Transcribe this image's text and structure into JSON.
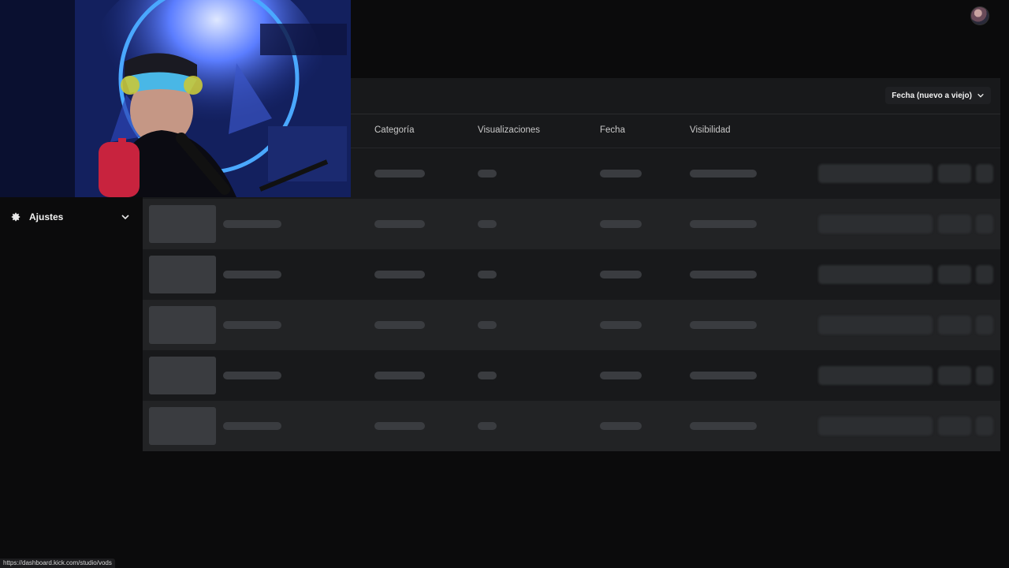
{
  "sidebar": {
    "items": [
      {
        "label": "Ajustes",
        "icon": "gear-icon"
      }
    ]
  },
  "toolbar": {
    "sort_label": "Fecha (nuevo a viejo)"
  },
  "table": {
    "columns": [
      "Categoría",
      "Visualizaciones",
      "Fecha",
      "Visibilidad"
    ],
    "rows_loading": 6
  },
  "status_bar": {
    "url": "https://dashboard.kick.com/studio/vods"
  },
  "colors": {
    "background": "#0b0b0c",
    "panel": "#18191b",
    "row_alt": "#222325",
    "skeleton": "#3a3c40"
  }
}
